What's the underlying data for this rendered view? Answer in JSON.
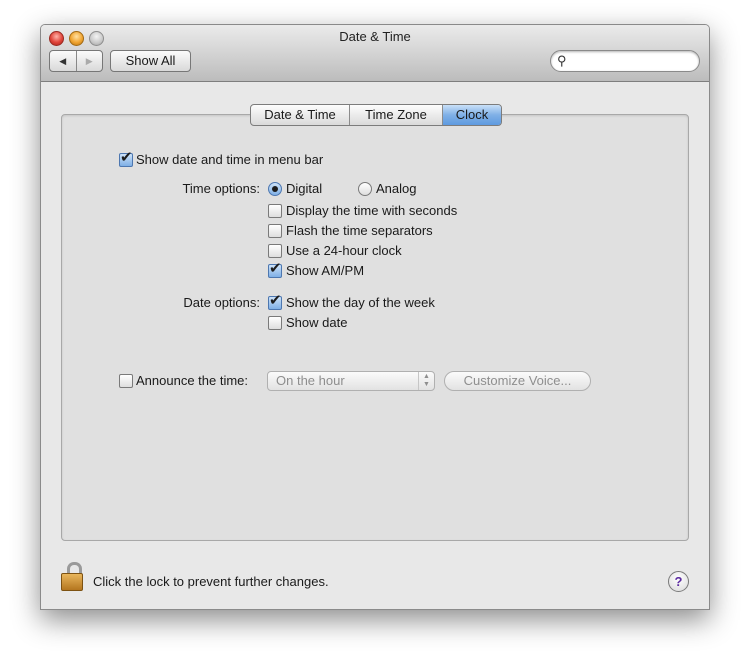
{
  "window": {
    "title": "Date & Time",
    "nav_back": "◀",
    "nav_forward": "▶",
    "show_all": "Show All",
    "search_value": "",
    "search_placeholder": ""
  },
  "tabs": [
    {
      "label": "Date & Time",
      "active": false
    },
    {
      "label": "Time Zone",
      "active": false
    },
    {
      "label": "Clock",
      "active": true
    }
  ],
  "clock": {
    "show_in_menu_bar": {
      "label": "Show date and time in menu bar",
      "checked": true
    },
    "time_options_label": "Time options:",
    "digital": {
      "label": "Digital",
      "selected": true
    },
    "analog": {
      "label": "Analog",
      "selected": false
    },
    "display_seconds": {
      "label": "Display the time with seconds",
      "checked": false
    },
    "flash_separators": {
      "label": "Flash the time separators",
      "checked": false
    },
    "use_24_hour": {
      "label": "Use a 24-hour clock",
      "checked": false
    },
    "show_ampm": {
      "label": "Show AM/PM",
      "checked": true
    },
    "date_options_label": "Date options:",
    "show_day_of_week": {
      "label": "Show the day of the week",
      "checked": true
    },
    "show_date": {
      "label": "Show date",
      "checked": false
    },
    "announce": {
      "label": "Announce the time:",
      "checked": false
    },
    "announce_interval": "On the hour",
    "customize_voice": "Customize Voice..."
  },
  "footer": {
    "lock_text": "Click the lock to prevent further changes.",
    "help": "?"
  },
  "colors": {
    "tab_active": "#7fb0e6",
    "help_glyph": "#5b2aa0",
    "lock_gold": "#d19a3c"
  },
  "icons": {
    "search": "magnifying-glass",
    "lock": "padlock-open",
    "help": "question-mark"
  }
}
